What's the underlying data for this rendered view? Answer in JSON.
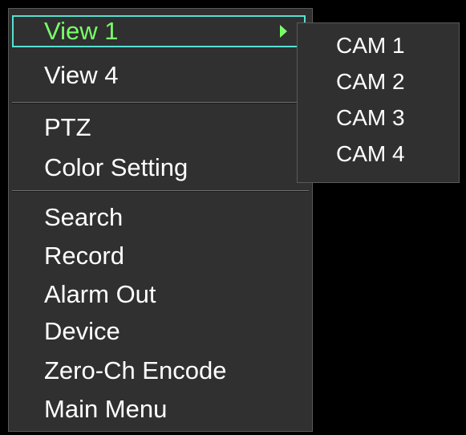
{
  "menu": {
    "items": [
      {
        "label": "View 1",
        "selected": true,
        "has_submenu": true
      },
      {
        "label": "View 4"
      },
      {
        "label": "PTZ"
      },
      {
        "label": "Color Setting"
      },
      {
        "label": "Search"
      },
      {
        "label": "Record"
      },
      {
        "label": "Alarm Out"
      },
      {
        "label": "Device"
      },
      {
        "label": "Zero-Ch Encode"
      },
      {
        "label": "Main Menu"
      }
    ]
  },
  "submenu": {
    "items": [
      {
        "label": "CAM 1"
      },
      {
        "label": "CAM 2"
      },
      {
        "label": "CAM 3"
      },
      {
        "label": "CAM 4"
      }
    ]
  },
  "colors": {
    "background": "#000000",
    "menu_bg": "#303030",
    "text": "#ffffff",
    "selected_text": "#7aff6a",
    "selection_border": "#56e0d2"
  }
}
